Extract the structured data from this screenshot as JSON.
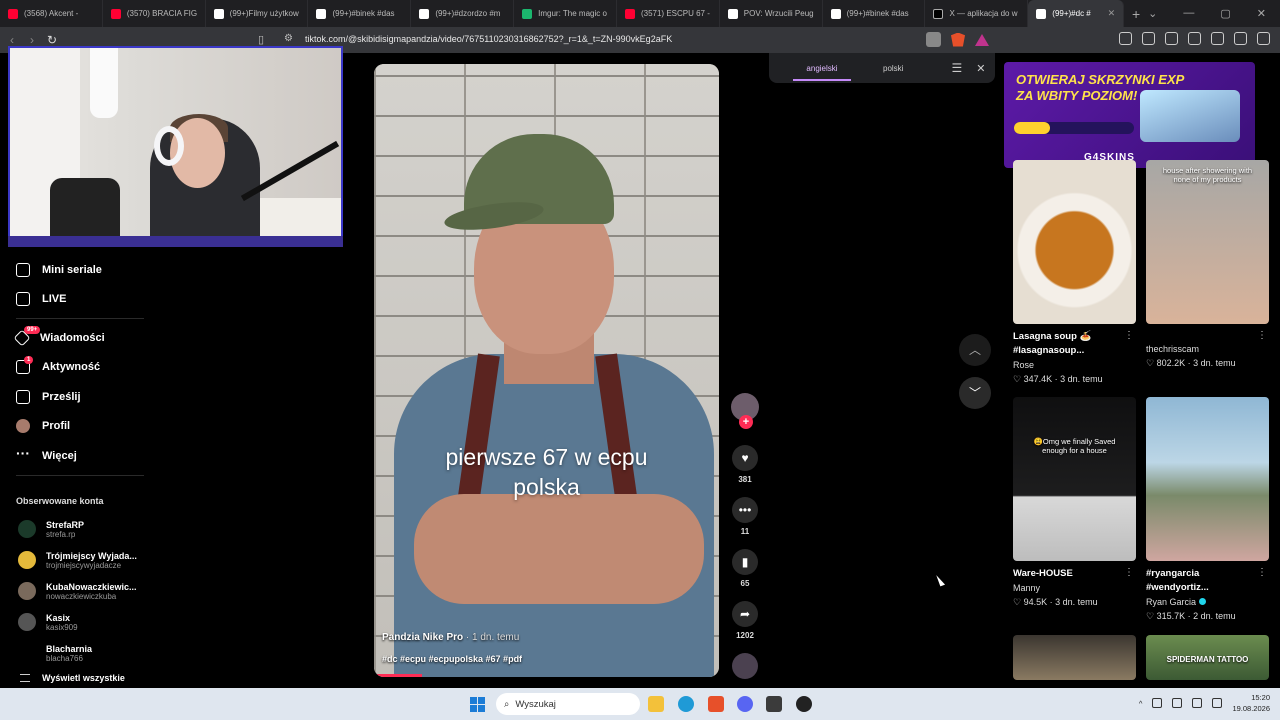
{
  "browser": {
    "tabs": [
      {
        "label": "(3568) Akcent -",
        "color": "#ff0033"
      },
      {
        "label": "(3570) BRACIA FIG",
        "color": "#ff0033"
      },
      {
        "label": "(99+)Filmy użytkow",
        "color": "#ffffff"
      },
      {
        "label": "(99+)#binek #das",
        "color": "#ffffff"
      },
      {
        "label": "(99+)#dzordzo #m",
        "color": "#ffffff"
      },
      {
        "label": "Imgur: The magic o",
        "color": "#1bb76e"
      },
      {
        "label": "(3571) ESCPU 67 -",
        "color": "#ff0033"
      },
      {
        "label": "POV: Wrzucili Peug",
        "color": "#ffffff"
      },
      {
        "label": "(99+)#binek #das",
        "color": "#ffffff"
      },
      {
        "label": "X — aplikacja do w",
        "color": "#ffffff"
      },
      {
        "label": "(99+)#dc #",
        "color": "#ffffff"
      }
    ],
    "url": "tiktok.com/@skibidisigmapandzia/video/7675110230316862752?_r=1&_t=ZN-990vkEg2aFK"
  },
  "translate_bar": {
    "lang_active": "angielski",
    "lang_other": "polski"
  },
  "sidebar": {
    "items": [
      {
        "label": "Mini seriale",
        "badge": ""
      },
      {
        "label": "LIVE",
        "badge": ""
      },
      {
        "label": "Wiadomości",
        "badge": "99+"
      },
      {
        "label": "Aktywność",
        "badge": "1"
      },
      {
        "label": "Prześlij",
        "badge": ""
      },
      {
        "label": "Profil",
        "badge": ""
      },
      {
        "label": "Więcej",
        "badge": ""
      }
    ],
    "followed_title": "Obserwowane konta",
    "accounts": [
      {
        "name": "StrefaRP",
        "handle": "strefa.rp",
        "color": "#1b3a2a"
      },
      {
        "name": "Trójmiejscy Wyjada...",
        "handle": "trojmiejscywyjadacze",
        "color": "#e4b93b"
      },
      {
        "name": "KubaNowaczkiewic...",
        "handle": "nowaczkiewiczkuba",
        "color": "#7a6a5c"
      },
      {
        "name": "Kasix",
        "handle": "kasix909",
        "color": "#555"
      },
      {
        "name": "Blacharnia",
        "handle": "blacha766",
        "color": "#000"
      }
    ],
    "show_all": "Wyświetl wszystkie"
  },
  "video": {
    "overlay_text_line1": "pierwsze 67 w ecpu",
    "overlay_text_line2": "polska",
    "author": "Pandzia Nike Pro",
    "time": " · 1 dn. temu",
    "tags": "#dc #ecpu #ecpupolska #67 #pdf",
    "likes": "381",
    "comments": "11",
    "saves": "65",
    "shares": "1202"
  },
  "ad": {
    "line1": "OTWIERAJ SKRZYNKI EXP",
    "line2": "ZA WBITY POZIOM!",
    "brand": "G4SKINS",
    "progress": 0.3
  },
  "feed": [
    {
      "title": "Lasagna soup 🍝 #lasagnasoup...",
      "author": "Rose",
      "stats": "♡ 347.4K · 3 dn. temu",
      "thumb_text": ""
    },
    {
      "title": "",
      "author": "thechrisscam",
      "stats": "♡ 802.2K · 3 dn. temu",
      "thumb_text": "house after showering with none of my products"
    },
    {
      "title": "Ware-HOUSE",
      "author": "Manny",
      "stats": "♡ 94.5K · 3 dn. temu",
      "thumb_text": "😩Omg we finally Saved enough for a house"
    },
    {
      "title": "#ryangarcia #wendyortiz...",
      "author": "Ryan Garcia",
      "stats": "♡ 315.7K · 2 dn. temu",
      "thumb_text": ""
    },
    {
      "title": "",
      "author": "",
      "stats": "",
      "thumb_text": ""
    },
    {
      "title": "",
      "author": "",
      "stats": "",
      "thumb_text": "SPIDERMAN TATTOO"
    }
  ],
  "taskbar": {
    "search_placeholder": "Wyszukaj",
    "time": "15:20",
    "date": "19.08.2026"
  }
}
